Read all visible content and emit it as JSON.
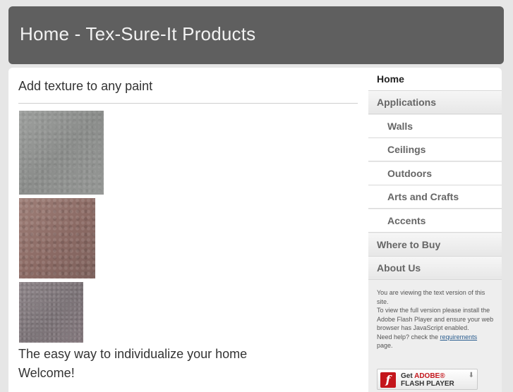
{
  "header": {
    "title": "Home - Tex-Sure-It Products"
  },
  "main": {
    "heading": "Add texture to any paint",
    "swatches": [
      {
        "name": "gray texture sample"
      },
      {
        "name": "rose texture sample"
      },
      {
        "name": "mauve texture sample"
      }
    ],
    "tagline": "The easy way to individualize your home",
    "welcome": "Welcome!"
  },
  "sidebar": {
    "items": [
      {
        "label": "Home"
      },
      {
        "label": "Applications"
      },
      {
        "label": "Walls"
      },
      {
        "label": "Ceilings"
      },
      {
        "label": "Outdoors"
      },
      {
        "label": "Arts and Crafts"
      },
      {
        "label": "Accents"
      },
      {
        "label": "Where to Buy"
      },
      {
        "label": "About Us"
      }
    ],
    "notice": {
      "line1": "You are viewing the text version of this site.",
      "line2": "To view the full version please install the Adobe Flash Player and ensure your web browser has JavaScript enabled.",
      "help_prefix": "Need help? check the ",
      "help_link": "requirements",
      "help_suffix": "page."
    },
    "flash_badge": {
      "get": "Get",
      "brand": "ADOBE®",
      "product": "FLASH PLAYER",
      "icon": "flash-icon"
    }
  }
}
